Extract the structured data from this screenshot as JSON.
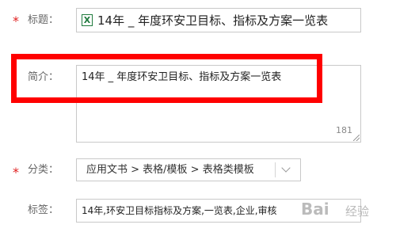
{
  "title_row": {
    "required_mark": "*",
    "label": "标题：",
    "file_icon": "excel-file-icon",
    "file_icon_glyph": "X",
    "value": "14年 _ 年度环安卫目标、指标及方案一览表"
  },
  "description_row": {
    "label": "简介：",
    "value": "14年 _ 年度环安卫目标、指标及方案一览表",
    "char_counter": "181"
  },
  "category_row": {
    "required_mark": "*",
    "label": "分类：",
    "value": "应用文书 > 表格/模板 > 表格类模板",
    "dropdown_icon": "chevron-down-icon"
  },
  "tags_row": {
    "label": "标签：",
    "value": "14年,环安卫目标指标及方案,一览表,企业,审核"
  },
  "annotation": {
    "color": "#ff0000"
  },
  "watermark": {
    "text": "Bai",
    "suffix": "经验"
  }
}
